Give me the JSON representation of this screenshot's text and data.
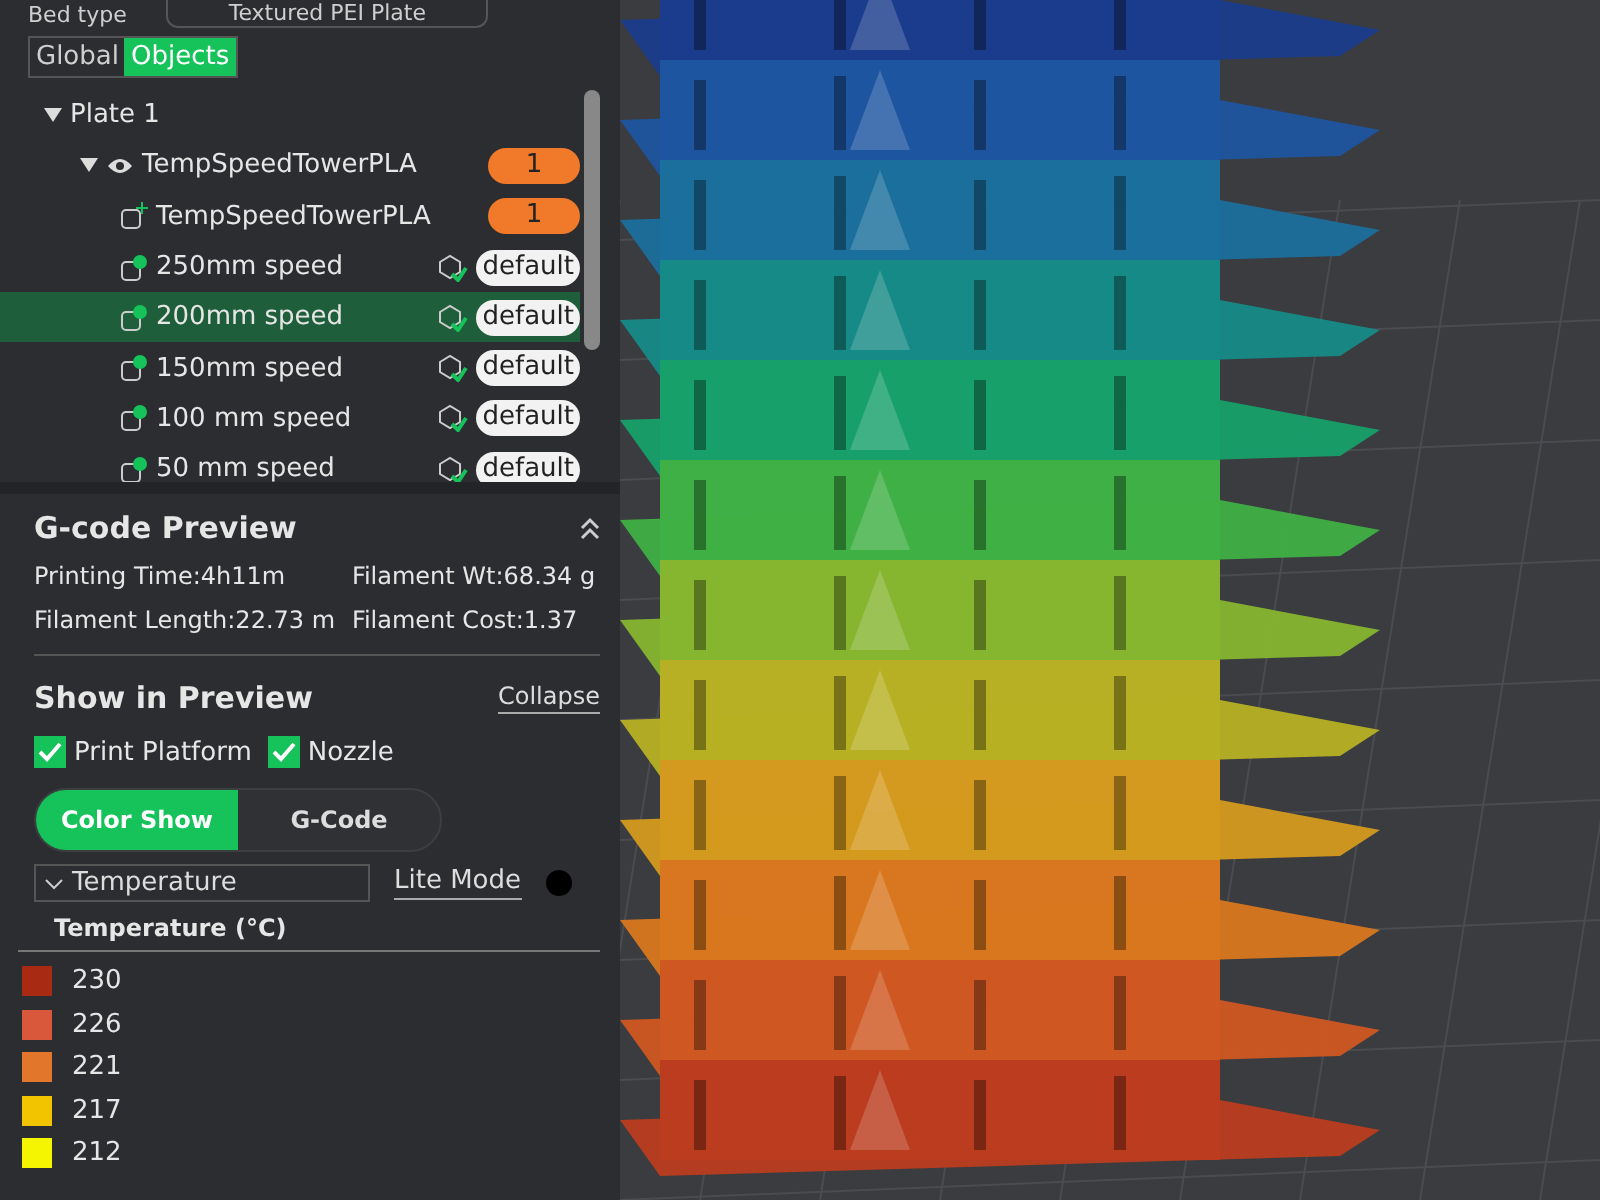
{
  "bed": {
    "label": "Bed type",
    "value": "Textured PEI Plate"
  },
  "tabs": [
    {
      "label": "Global",
      "selected": false
    },
    {
      "label": "Objects",
      "selected": true
    }
  ],
  "tree": [
    {
      "kind": "plate",
      "label": "Plate 1",
      "expanded": true,
      "selected": false,
      "children": [
        {
          "kind": "object",
          "label": "TempSpeedTowerPLA",
          "badge": "1",
          "expanded": true,
          "selected": false,
          "children": [
            {
              "kind": "part",
              "label": "TempSpeedTowerPLA",
              "badge": "1",
              "selected": false
            },
            {
              "kind": "modifier",
              "label": "250mm speed",
              "badge": "default",
              "selected": false
            },
            {
              "kind": "modifier",
              "label": "200mm speed",
              "badge": "default",
              "selected": true
            },
            {
              "kind": "modifier",
              "label": "150mm speed",
              "badge": "default",
              "selected": false
            },
            {
              "kind": "modifier",
              "label": "100 mm speed",
              "badge": "default",
              "selected": false
            },
            {
              "kind": "modifier",
              "label": "50 mm speed",
              "badge": "default",
              "selected": false
            }
          ]
        }
      ]
    }
  ],
  "gcode": {
    "title": "G-code Preview",
    "stats": [
      "Printing Time:4h11m",
      "Filament Wt:68.34 g",
      "Filament Length:22.73 m",
      "Filament Cost:1.37"
    ]
  },
  "preview": {
    "title": "Show in Preview",
    "collapse": "Collapse",
    "checks": [
      {
        "label": "Print Platform",
        "checked": true
      },
      {
        "label": "Nozzle",
        "checked": true
      }
    ],
    "modes": [
      {
        "label": "Color Show",
        "selected": true
      },
      {
        "label": "G-Code",
        "selected": false
      }
    ],
    "scheme": "Temperature",
    "lite_mode": "Lite Mode",
    "lite_on": false
  },
  "legend": {
    "title": "Temperature (°C)",
    "items": [
      {
        "label": "230",
        "color": "#a82a12"
      },
      {
        "label": "226",
        "color": "#d9573a"
      },
      {
        "label": "221",
        "color": "#e2762a"
      },
      {
        "label": "217",
        "color": "#f2c400"
      },
      {
        "label": "212",
        "color": "#f5f500"
      }
    ]
  }
}
